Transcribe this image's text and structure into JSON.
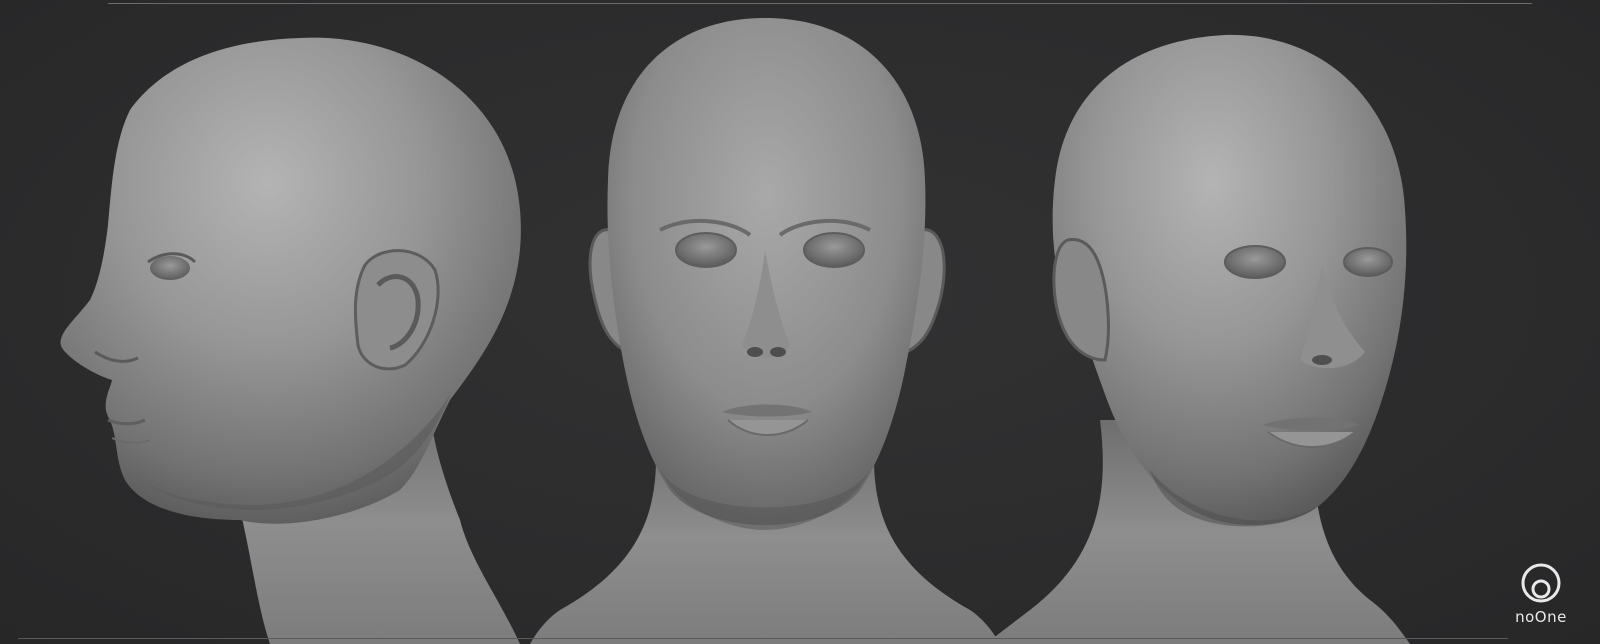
{
  "scene": {
    "subject": "sculpted-head-three-views",
    "views": [
      "profile-left",
      "front",
      "three-quarter-right"
    ],
    "colors": {
      "background": "#2b2b2c",
      "clay_light": "#a8a8a8",
      "clay_mid": "#8a8a8a",
      "clay_dark": "#4c4c4c",
      "rule_line": "#6c6c6c"
    }
  },
  "watermark": {
    "text": "noOne",
    "icon": "noone-logo-icon"
  }
}
